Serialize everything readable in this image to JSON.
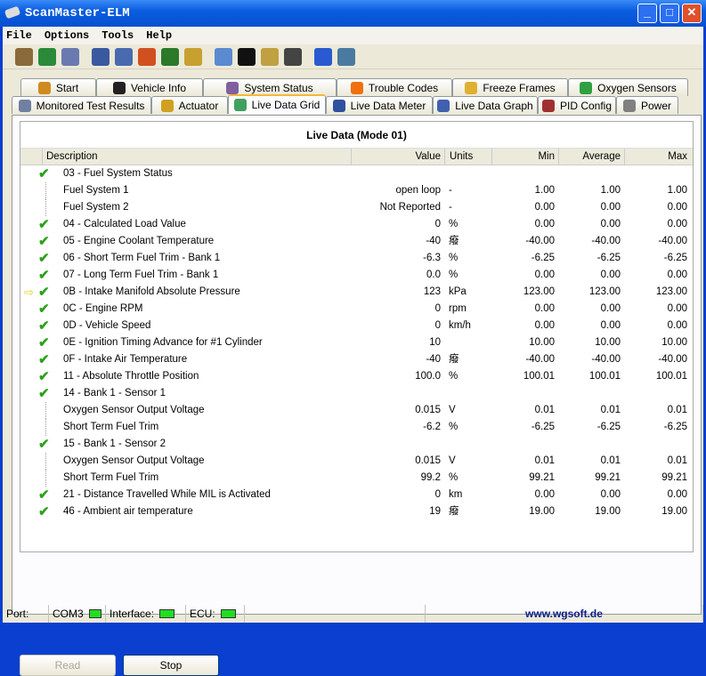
{
  "window": {
    "title": "ScanMaster-ELM",
    "minimize": "_",
    "maximize": "□",
    "close": "✕"
  },
  "menu": [
    "File",
    "Options",
    "Tools",
    "Help"
  ],
  "toolbar": [
    "connect-icon",
    "globe-icon",
    "report-icon",
    "grid-icon",
    "graph-icon",
    "color-icon",
    "user-icon",
    "clipboard-icon",
    "chat-icon",
    "terminal-icon",
    "battery-icon",
    "gauge-icon",
    "info-icon",
    "exit-icon"
  ],
  "tabs_row1": [
    {
      "label": "Start",
      "icon": "house-icon"
    },
    {
      "label": "Vehicle Info",
      "icon": "info-icon"
    },
    {
      "label": "System Status",
      "icon": "status-icon"
    },
    {
      "label": "Trouble Codes",
      "icon": "warning-icon"
    },
    {
      "label": "Freeze Frames",
      "icon": "snowflake-icon"
    },
    {
      "label": "Oxygen Sensors",
      "icon": "sensor-icon"
    }
  ],
  "tabs_row2": [
    {
      "label": "Monitored Test Results",
      "icon": "gear-icon"
    },
    {
      "label": "Actuator",
      "icon": "actuator-icon"
    },
    {
      "label": "Live Data Grid",
      "icon": "grid-icon",
      "active": true
    },
    {
      "label": "Live Data Meter",
      "icon": "meter-icon"
    },
    {
      "label": "Live Data Graph",
      "icon": "graph-icon"
    },
    {
      "label": "PID Config",
      "icon": "config-icon"
    },
    {
      "label": "Power",
      "icon": "power-icon"
    }
  ],
  "grid": {
    "title": "Live Data (Mode 01)",
    "columns": {
      "description": "Description",
      "value": "Value",
      "units": "Units",
      "min": "Min",
      "average": "Average",
      "max": "Max"
    },
    "rows": [
      {
        "d": "03 - Fuel System Status",
        "v": "",
        "u": "",
        "min": "",
        "avg": "",
        "max": "",
        "status": "ok"
      },
      {
        "d": "Fuel System 1",
        "v": "open loop",
        "u": "-",
        "min": "1.00",
        "avg": "1.00",
        "max": "1.00",
        "status": "child"
      },
      {
        "d": "Fuel System 2",
        "v": "Not Reported",
        "u": "-",
        "min": "0.00",
        "avg": "0.00",
        "max": "0.00",
        "status": "child"
      },
      {
        "d": "04 - Calculated Load Value",
        "v": "0",
        "u": "%",
        "min": "0.00",
        "avg": "0.00",
        "max": "0.00",
        "status": "ok"
      },
      {
        "d": "05 - Engine Coolant Temperature",
        "v": "-40",
        "u": "癈",
        "min": "-40.00",
        "avg": "-40.00",
        "max": "-40.00",
        "status": "ok"
      },
      {
        "d": "06 - Short Term Fuel Trim - Bank 1",
        "v": "-6.3",
        "u": "%",
        "min": "-6.25",
        "avg": "-6.25",
        "max": "-6.25",
        "status": "ok"
      },
      {
        "d": "07 - Long Term Fuel Trim - Bank 1",
        "v": "0.0",
        "u": "%",
        "min": "0.00",
        "avg": "0.00",
        "max": "0.00",
        "status": "ok"
      },
      {
        "d": "0B - Intake Manifold Absolute Pressure",
        "v": "123",
        "u": "kPa",
        "min": "123.00",
        "avg": "123.00",
        "max": "123.00",
        "status": "selected"
      },
      {
        "d": "0C - Engine RPM",
        "v": "0",
        "u": "rpm",
        "min": "0.00",
        "avg": "0.00",
        "max": "0.00",
        "status": "ok"
      },
      {
        "d": "0D - Vehicle Speed",
        "v": "0",
        "u": "km/h",
        "min": "0.00",
        "avg": "0.00",
        "max": "0.00",
        "status": "ok"
      },
      {
        "d": "0E - Ignition Timing Advance for #1 Cylinder",
        "v": "10",
        "u": "",
        "min": "10.00",
        "avg": "10.00",
        "max": "10.00",
        "status": "ok"
      },
      {
        "d": "0F - Intake Air Temperature",
        "v": "-40",
        "u": "癈",
        "min": "-40.00",
        "avg": "-40.00",
        "max": "-40.00",
        "status": "ok"
      },
      {
        "d": "11 - Absolute Throttle Position",
        "v": "100.0",
        "u": "%",
        "min": "100.01",
        "avg": "100.01",
        "max": "100.01",
        "status": "ok"
      },
      {
        "d": "14 - Bank 1 - Sensor 1",
        "v": "",
        "u": "",
        "min": "",
        "avg": "",
        "max": "",
        "status": "ok"
      },
      {
        "d": "Oxygen Sensor Output Voltage",
        "v": "0.015",
        "u": "V",
        "min": "0.01",
        "avg": "0.01",
        "max": "0.01",
        "status": "child"
      },
      {
        "d": "Short Term Fuel Trim",
        "v": "-6.2",
        "u": "%",
        "min": "-6.25",
        "avg": "-6.25",
        "max": "-6.25",
        "status": "child"
      },
      {
        "d": "15 - Bank 1 - Sensor 2",
        "v": "",
        "u": "",
        "min": "",
        "avg": "",
        "max": "",
        "status": "ok"
      },
      {
        "d": "Oxygen Sensor Output Voltage",
        "v": "0.015",
        "u": "V",
        "min": "0.01",
        "avg": "0.01",
        "max": "0.01",
        "status": "child"
      },
      {
        "d": "Short Term Fuel Trim",
        "v": "99.2",
        "u": "%",
        "min": "99.21",
        "avg": "99.21",
        "max": "99.21",
        "status": "child"
      },
      {
        "d": "21 - Distance Travelled While MIL is Activated",
        "v": "0",
        "u": "km",
        "min": "0.00",
        "avg": "0.00",
        "max": "0.00",
        "status": "ok"
      },
      {
        "d": "46 - Ambient air temperature",
        "v": "19",
        "u": "癈",
        "min": "19.00",
        "avg": "19.00",
        "max": "19.00",
        "status": "ok"
      }
    ]
  },
  "buttons": {
    "read": "Read",
    "stop": "Stop"
  },
  "status": {
    "port_label": "Port:",
    "port": "COM3",
    "interface_label": "Interface:",
    "ecu_label": "ECU:",
    "website": "www.wgsoft.de",
    "led_color": "#22dd22"
  }
}
